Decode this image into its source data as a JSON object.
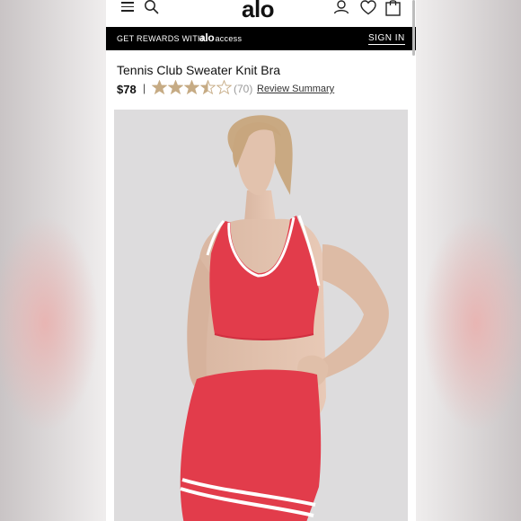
{
  "header": {
    "logo_text": "alo",
    "icons": [
      "menu-icon",
      "search-icon",
      "account-icon",
      "heart-icon",
      "bag-icon"
    ]
  },
  "rewards_banner": {
    "text": "GET REWARDS WITH",
    "brand_bold": "alo",
    "brand_thin": "access",
    "sign_in": "SIGN IN"
  },
  "product": {
    "title": "Tennis Club Sweater Knit Bra",
    "price": "$78",
    "separator": "|",
    "rating": 3.5,
    "rating_max": 5,
    "review_count": "(70)",
    "review_link": "Review Summary"
  },
  "colors": {
    "star": "#c6ab84",
    "garment": "#e23c4b",
    "banner": "#000000"
  }
}
